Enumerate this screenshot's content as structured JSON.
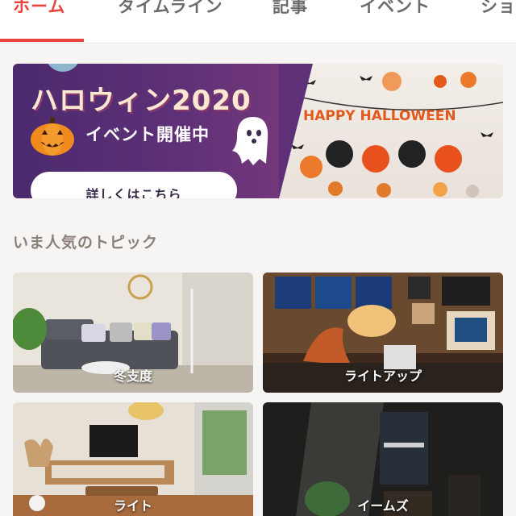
{
  "tabs": [
    {
      "label": "ホーム",
      "active": true
    },
    {
      "label": "タイムライン",
      "active": false
    },
    {
      "label": "記事",
      "active": false
    },
    {
      "label": "イベント",
      "active": false
    },
    {
      "label": "ショ",
      "active": false
    }
  ],
  "banner": {
    "title": "ハロウィン2020",
    "subtitle": "イベント開催中",
    "button_label": "詳しくはこちら",
    "garland_text": "HAPPY HALLOWEEN"
  },
  "section": {
    "title": "いま人気のトピック"
  },
  "topics": [
    {
      "label": "冬支度"
    },
    {
      "label": "ライトアップ"
    },
    {
      "label": "ライト"
    },
    {
      "label": "イームズ"
    }
  ],
  "colors": {
    "accent": "#e8453c",
    "tab_text": "#6b6b6b",
    "banner_purple": "#5e3078",
    "section_title": "#8a8078"
  },
  "icons": [
    "pumpkin-icon",
    "ghost-icon",
    "bat-icon"
  ]
}
